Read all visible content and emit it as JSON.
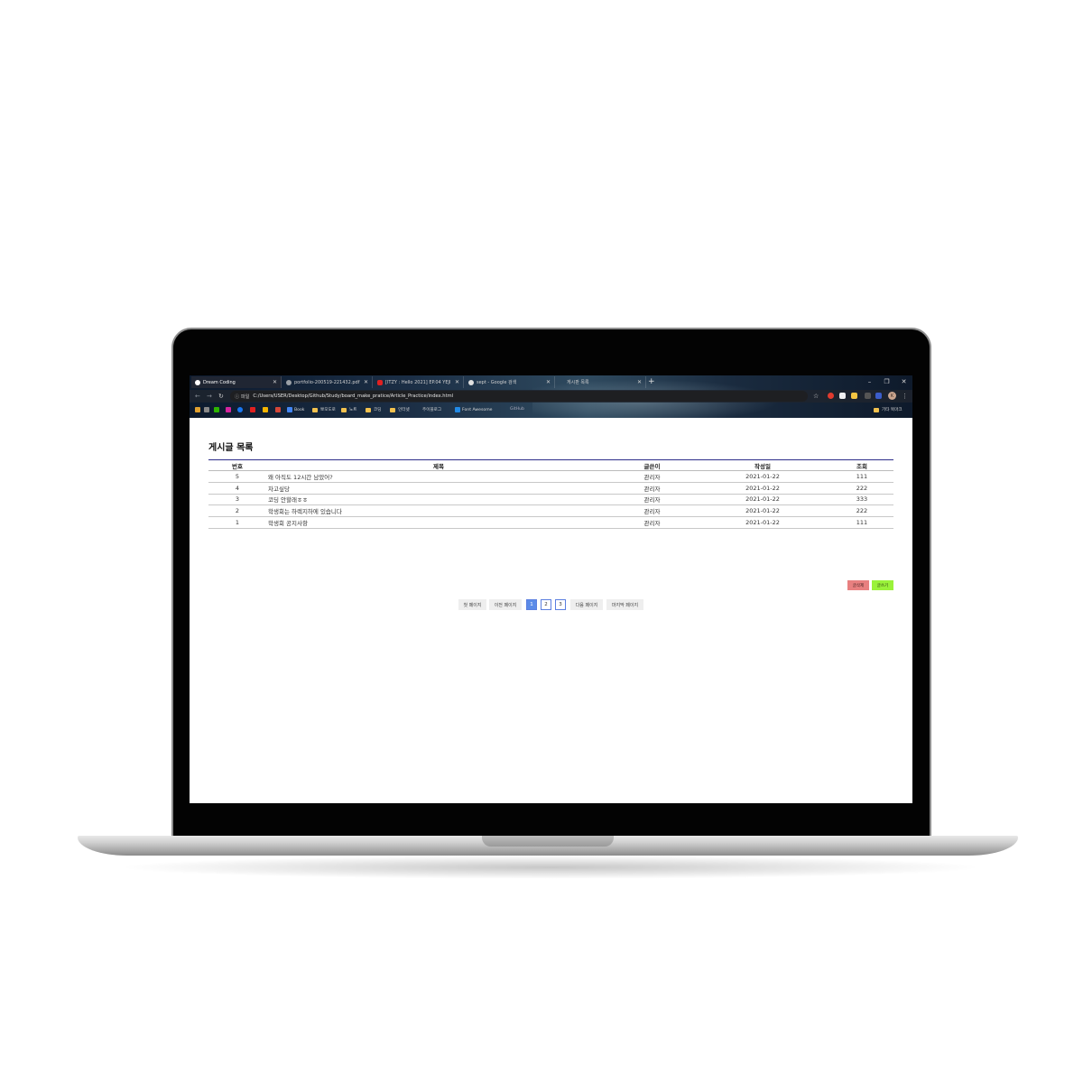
{
  "browser": {
    "tabs": [
      {
        "title": "Dream Coding",
        "active": true
      },
      {
        "title": "portfolio-200519-221432.pdf",
        "active": false
      },
      {
        "title": "[ITZY : Hello 2021] EP.04 YEJI",
        "active": false
      },
      {
        "title": "sept - Google 검색",
        "active": false
      },
      {
        "title": "게시판 목록",
        "active": false
      }
    ],
    "new_tab": "+",
    "window_buttons": [
      "–",
      "❐",
      "✕"
    ],
    "address_scheme": "ⓘ 파일",
    "address_url": "C:/Users/USER/Desktop/Github/Study/board_make_pratice/Article_Practice/index.html",
    "avatar_letter": "K",
    "bookmarks": [
      "Book",
      "뽀모도로",
      "노트",
      "코딩",
      "인터넷",
      "주이블로그",
      "Font Awesome",
      "GitHub",
      "기타 북마크"
    ]
  },
  "board": {
    "title": "게시글 목록",
    "columns": [
      "번호",
      "제목",
      "글쓴이",
      "작성일",
      "조회"
    ],
    "rows": [
      {
        "num": "5",
        "title": "왜 아직도 12시간 남았어?",
        "author": "관리자",
        "date": "2021-01-22",
        "views": "111"
      },
      {
        "num": "4",
        "title": "차고싶당",
        "author": "관리자",
        "date": "2021-01-22",
        "views": "222"
      },
      {
        "num": "3",
        "title": "코딩 안할래ㅎㅎ",
        "author": "관리자",
        "date": "2021-01-22",
        "views": "333"
      },
      {
        "num": "2",
        "title": "학생회는 하렉지하에 있습니다",
        "author": "관리자",
        "date": "2021-01-22",
        "views": "222"
      },
      {
        "num": "1",
        "title": "학생회 공지사항",
        "author": "관리자",
        "date": "2021-01-22",
        "views": "111"
      }
    ],
    "delete_label": "글삭제",
    "write_label": "글쓰기"
  },
  "pagination": {
    "first": "첫 페이지",
    "prev": "이전 페이지",
    "pages": [
      "1",
      "2",
      "3"
    ],
    "current": "1",
    "next": "다음 페이지",
    "last": "마지막 페이지"
  },
  "colors": {
    "header_rule": "#2d2d8a",
    "delete_button": "#e88080",
    "write_button": "#9af23a",
    "current_page": "#5b8be8"
  }
}
